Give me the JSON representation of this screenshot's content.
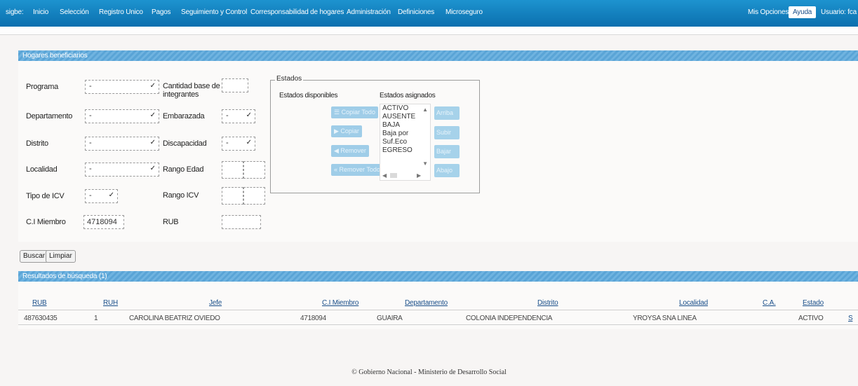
{
  "topnav": {
    "brand": "sigbe:",
    "items": [
      "Inicio",
      "Selección",
      "Registro Unico",
      "Pagos",
      "Seguimiento y Control",
      "Corresponsabilidad de hogares",
      "Administración",
      "Definiciones",
      "Microseguro"
    ],
    "right": {
      "options": "Mis Opciones",
      "help": "Ayuda",
      "user": "Usuario: fca"
    }
  },
  "filter_panel": {
    "title": "Hogares beneficiarios",
    "fields": {
      "programa": {
        "label": "Programa",
        "value": "-"
      },
      "departamento": {
        "label": "Departamento",
        "value": "-"
      },
      "distrito": {
        "label": "Distrito",
        "value": "-"
      },
      "localidad": {
        "label": "Localidad",
        "value": "-"
      },
      "tipo_icv": {
        "label": "Tipo de ICV",
        "value": "-"
      },
      "cimiembro": {
        "label": "C.I Miembro",
        "value": "4718094"
      },
      "cantidad_base": {
        "label_line1": "Cantidad base de",
        "label_line2": "integrantes",
        "value": ""
      },
      "embarazada": {
        "label": "Embarazada",
        "value": "-"
      },
      "discapacidad": {
        "label": "Discapacidad",
        "value": "-"
      },
      "rango_edad": {
        "label": "Rango Edad"
      },
      "rango_icv": {
        "label": "Rango ICV"
      },
      "rub": {
        "label": "RUB",
        "value": ""
      }
    },
    "estados": {
      "legend": "Estados",
      "available_label": "Estados disponibles",
      "assigned_label": "Estados asignados",
      "assigned": [
        "ACTIVO",
        "AUSENTE",
        "BAJA",
        "Baja por Suf.Eco",
        "EGRESO"
      ],
      "transfer_buttons": [
        "Copiar Todo",
        "Copiar",
        "Remover",
        "Remover Todo"
      ],
      "side_buttons": [
        "Arriba",
        "Subir",
        "Bajar",
        "Abajo"
      ]
    },
    "buttons": {
      "search": "Buscar",
      "clear": "Limpiar"
    }
  },
  "results": {
    "title": "Resultados de búsqueda (1)",
    "columns": [
      "RUB",
      "RUH",
      "Jefe",
      "C.I Miembro",
      "Departamento",
      "Distrito",
      "Localidad",
      "C.A.",
      "Estado"
    ],
    "rows": [
      {
        "rub": "487630435",
        "ruh": "1",
        "jefe": "CAROLINA BEATRIZ OVIEDO",
        "cimiembro": "4718094",
        "departamento": "GUAIRA",
        "distrito": "COLONIA INDEPENDENCIA",
        "localidad": "YROYSA SNA LINEA",
        "ca": "",
        "estado": "ACTIVO",
        "link": "S"
      }
    ]
  },
  "footer": "© Gobierno Nacional - Ministerio de Desarrollo Social"
}
